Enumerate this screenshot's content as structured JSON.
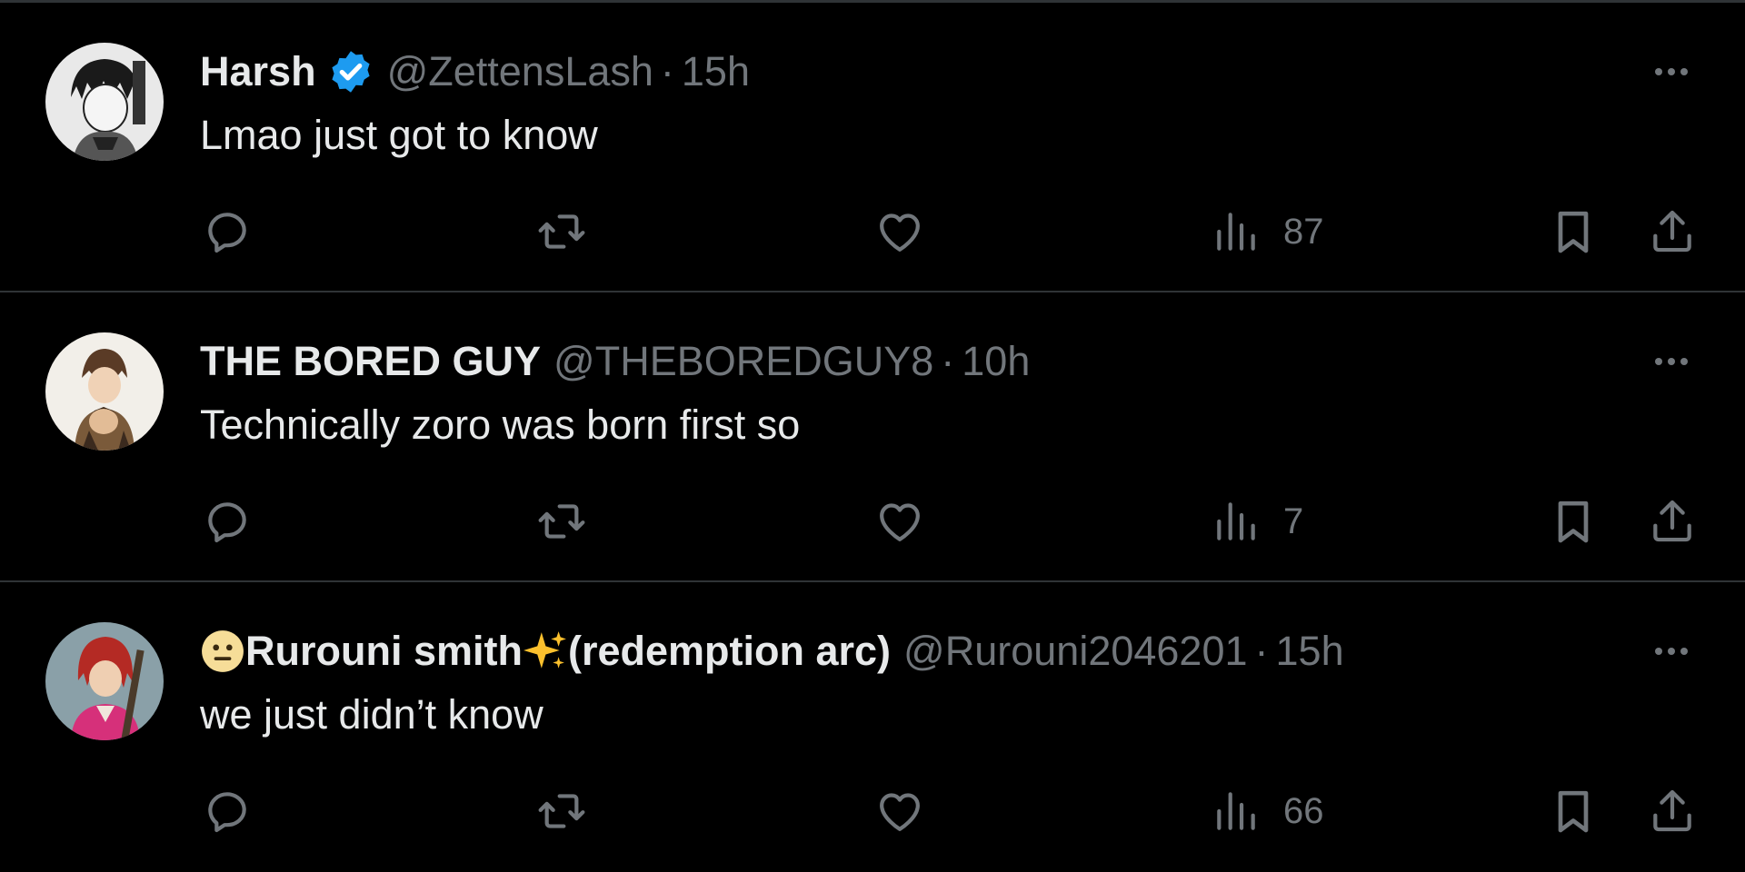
{
  "tweets": [
    {
      "name": "Harsh",
      "verified": true,
      "handle": "@ZettensLash",
      "separator": "·",
      "time": "15h",
      "text": "Lmao just got to know",
      "views": "87"
    },
    {
      "name": "THE BORED GUY",
      "verified": false,
      "handle": "@THEBOREDGUY8",
      "separator": "·",
      "time": "10h",
      "text": "Technically zoro was born first so",
      "views": "7"
    },
    {
      "name_prefix_emoji": "neutral-face-emoji",
      "name": "Rurouni smith",
      "name_mid_emoji": "sparkles-emoji",
      "name_suffix": "(redemption arc)",
      "verified": false,
      "handle": "@Rurouni2046201",
      "separator": "·",
      "time": "15h",
      "text": "we just didn’t know",
      "views": "66"
    }
  ],
  "icons": {
    "reply": "reply-icon",
    "retweet": "retweet-icon",
    "like": "like-icon",
    "views": "views-icon",
    "bookmark": "bookmark-icon",
    "share": "share-icon",
    "more": "more-icon",
    "verified": "verified-badge-icon"
  },
  "colors": {
    "background": "#000000",
    "primary_text": "#e7e9ea",
    "secondary_text": "#71767b",
    "divider": "#2f3336",
    "verified_blue": "#1d9bf0"
  }
}
